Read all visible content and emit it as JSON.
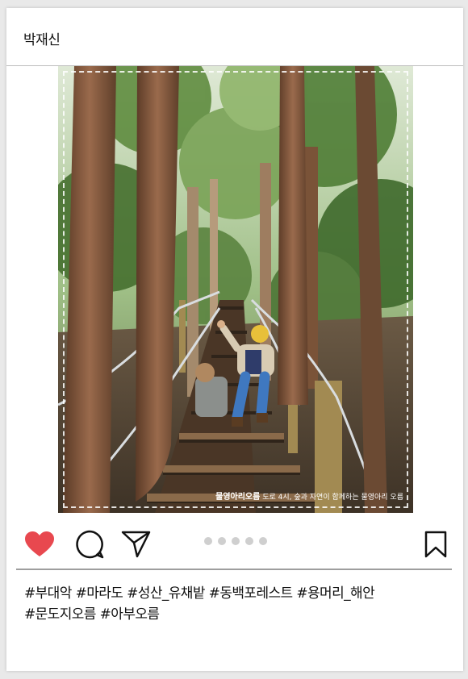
{
  "post": {
    "username": "박재신",
    "photo": {
      "watermark_brand": "물영아리오름",
      "watermark_text": "도로 4시, 숲과 자연이 함께하는 물영아리 오름"
    },
    "carousel": {
      "total": 5,
      "active": 0
    },
    "caption_lines": [
      "#부대악 #마라도 #성산_유채밭 #동백포레스트 #용머리_해안",
      "#문도지오름 #아부오름"
    ]
  },
  "colors": {
    "heart": "#e8484f",
    "dot": "#cfcfcf",
    "divider": "#9e9e9e"
  },
  "icons": [
    "heart-icon",
    "comment-icon",
    "share-icon",
    "bookmark-icon"
  ]
}
